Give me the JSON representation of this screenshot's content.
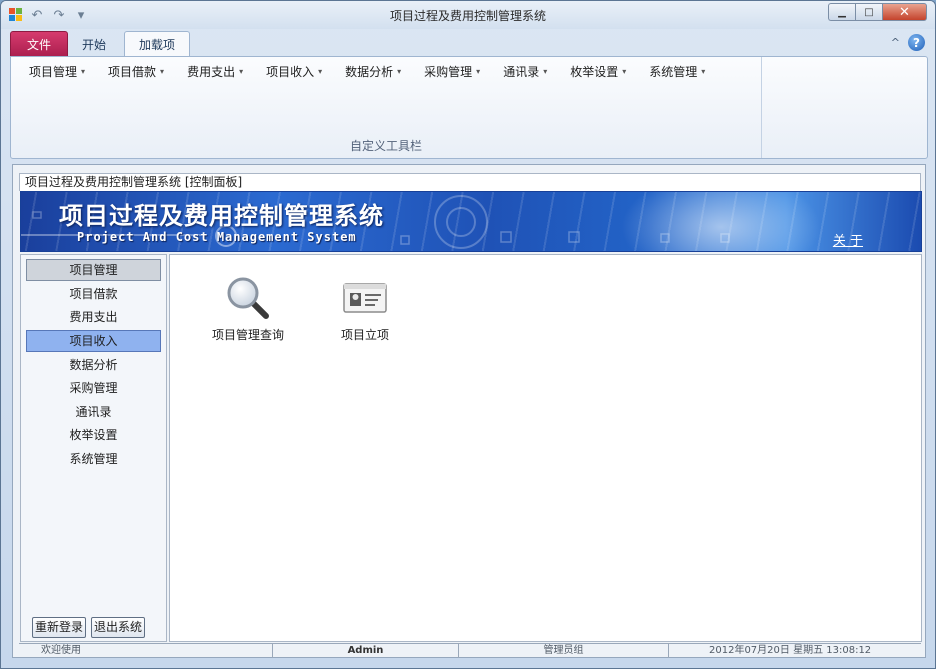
{
  "window": {
    "title": "项目过程及费用控制管理系统",
    "controls": {
      "minimize": "▁",
      "maximize": "□",
      "close": "✕"
    }
  },
  "quick_access": {
    "undo": "↶",
    "redo": "↷",
    "customize": "▾"
  },
  "ribbon": {
    "tabs": [
      {
        "label": "文件"
      },
      {
        "label": "开始"
      },
      {
        "label": "加载项",
        "active": true
      }
    ],
    "collapse_glyph": "^",
    "help_glyph": "?",
    "menus": [
      {
        "label": "项目管理"
      },
      {
        "label": "项目借款"
      },
      {
        "label": "费用支出"
      },
      {
        "label": "项目收入"
      },
      {
        "label": "数据分析"
      },
      {
        "label": "采购管理"
      },
      {
        "label": "通讯录"
      },
      {
        "label": "枚举设置"
      },
      {
        "label": "系统管理"
      }
    ],
    "dropdown_glyph": "▾",
    "group_label": "自定义工具栏"
  },
  "panel": {
    "title": "项目过程及费用控制管理系统 [控制面板]",
    "banner": {
      "title": "项目过程及费用控制管理系统",
      "subtitle": "Project And Cost Management System",
      "about_link": "关 于"
    }
  },
  "nav": {
    "items": [
      {
        "label": "项目管理",
        "state": "selected"
      },
      {
        "label": "项目借款",
        "state": ""
      },
      {
        "label": "费用支出",
        "state": ""
      },
      {
        "label": "项目收入",
        "state": "hover"
      },
      {
        "label": "数据分析",
        "state": ""
      },
      {
        "label": "采购管理",
        "state": ""
      },
      {
        "label": "通讯录",
        "state": ""
      },
      {
        "label": "枚举设置",
        "state": ""
      },
      {
        "label": "系统管理",
        "state": ""
      }
    ],
    "relogin_label": "重新登录",
    "exit_label": "退出系统"
  },
  "content": {
    "tiles": [
      {
        "label": "项目管理查询",
        "icon": "magnifier-icon"
      },
      {
        "label": "项目立项",
        "icon": "id-card-icon"
      }
    ]
  },
  "statusbar": {
    "welcome": "欢迎使用",
    "user": "Admin",
    "role": "管理员组",
    "datetime": "2012年07月20日 星期五 13:08:12"
  },
  "colors": {
    "file_tab": "#c0245a",
    "nav_hover": "#8fb2ef",
    "banner_blue": "#1f52b6"
  }
}
